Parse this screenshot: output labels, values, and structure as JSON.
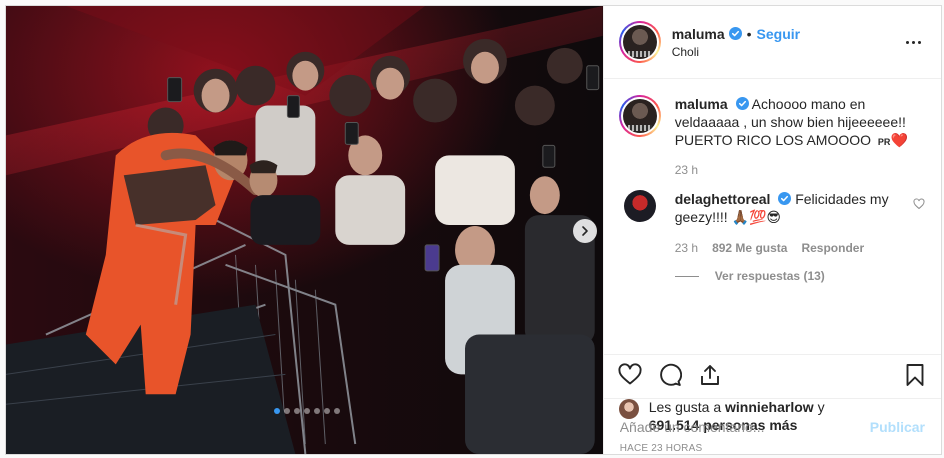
{
  "post": {
    "header": {
      "username": "maluma",
      "separator": "•",
      "follow_label": "Seguir",
      "location": "Choli",
      "more_icon": "more-horizontal-icon"
    },
    "caption": {
      "username": "maluma",
      "text": "Achoooo mano en veldaaaaa , un show bien hijeeeeee!! PUERTO RICO LOS AMOOOO",
      "flag_text": "PR",
      "heart_emoji": "❤️",
      "time": "23 h"
    },
    "comments": [
      {
        "username": "delaghettoreal",
        "text": "Felicidades my geezy!!!! 🙏🏾💯😎",
        "time": "23 h",
        "likes": "892 Me gusta",
        "reply_label": "Responder",
        "view_replies": "Ver respuestas (13)"
      }
    ],
    "likes": {
      "prefix": "Les gusta a",
      "user": "winnieharlow",
      "conjunction": "y",
      "count": "691.514 personas más"
    },
    "timestamp": "Hace 23 horas",
    "add_comment": {
      "placeholder": "Añade un comentario...",
      "publish_label": "Publicar"
    },
    "carousel": {
      "slide_count": 7,
      "active_index": 0
    },
    "colors": {
      "link": "#3897f0",
      "verified": "#3897f0",
      "publish_disabled": "#b2dffc",
      "heart": "#ed4956"
    }
  }
}
